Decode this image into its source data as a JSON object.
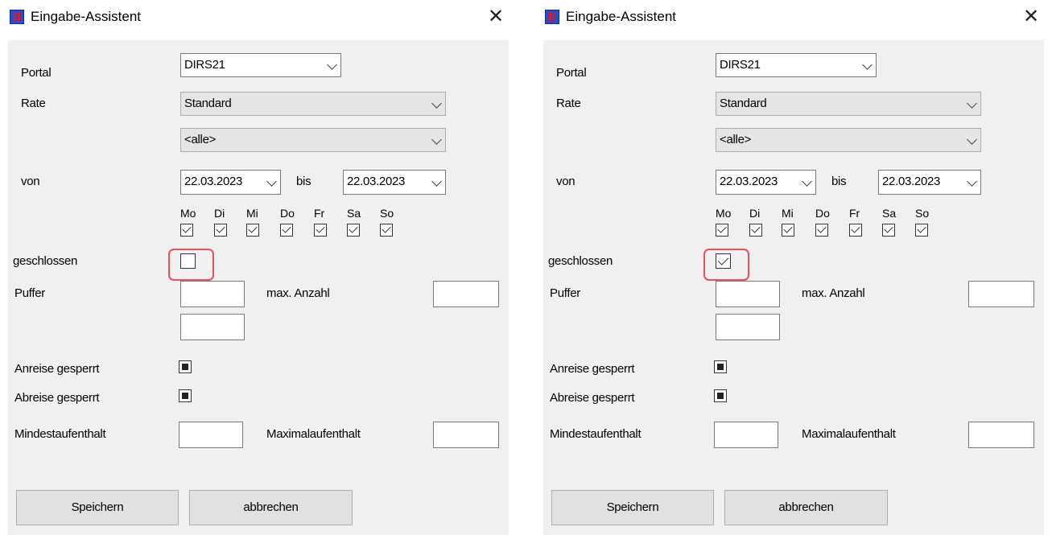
{
  "dialog": {
    "title": "Eingabe-Assistent",
    "close_glyph": "✕",
    "portal_label": "Portal",
    "portal_value": "DIRS21",
    "rate_label": "Rate",
    "rate_value": "Standard",
    "rate_sub_value": "<alle>",
    "von_label": "von",
    "von_date": "22.03.2023",
    "bis_label": "bis",
    "bis_date": "22.03.2023",
    "weekdays": [
      "Mo",
      "Di",
      "Mi",
      "Do",
      "Fr",
      "Sa",
      "So"
    ],
    "geschlossen_label": "geschlossen",
    "puffer_label": "Puffer",
    "max_anzahl_label": "max. Anzahl",
    "anreise_label": "Anreise gesperrt",
    "abreise_label": "Abreise gesperrt",
    "mindest_label": "Mindestaufenthalt",
    "maximal_label": "Maximalaufenthalt",
    "save_label": "Speichern",
    "cancel_label": "abbrechen"
  },
  "panels": [
    {
      "weekdays_checked": [
        true,
        true,
        true,
        true,
        true,
        true,
        true
      ],
      "geschlossen_checked": false,
      "anreise_indeterminate": true,
      "abreise_indeterminate": true
    },
    {
      "weekdays_checked": [
        true,
        true,
        true,
        true,
        true,
        true,
        true
      ],
      "geschlossen_checked": true,
      "anreise_indeterminate": true,
      "abreise_indeterminate": true
    }
  ],
  "colors": {
    "highlight": "#e8505b",
    "client_bg": "#f0f0f0",
    "button_bg": "#e1e1e1"
  },
  "icons": [
    "app-icon",
    "close-icon",
    "chevron-down-icon",
    "checkbox-check-icon",
    "checkbox-indeterminate-icon"
  ]
}
